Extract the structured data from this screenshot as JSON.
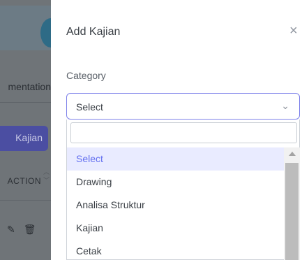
{
  "background": {
    "tab_label": "mentation",
    "kajian_button": "Kajian",
    "table_header": "ACTION",
    "sort_up": "︿",
    "sort_down": "﹀",
    "edit_icon": "✎",
    "delete_icon": "🗑"
  },
  "modal": {
    "title": "Add Kajian",
    "close_icon": "×",
    "category_label": "Category",
    "select_value": "Select",
    "chevron": "⌄",
    "search_value": "",
    "options": [
      "Select",
      "Drawing",
      "Analisa Struktur",
      "Kajian",
      "Cetak"
    ],
    "selected_option": "Select"
  },
  "colors": {
    "accent": "#6470f0",
    "selected_bg": "#e9ebff",
    "border_focus": "#7f83ea",
    "backdrop": "#6f7478"
  }
}
